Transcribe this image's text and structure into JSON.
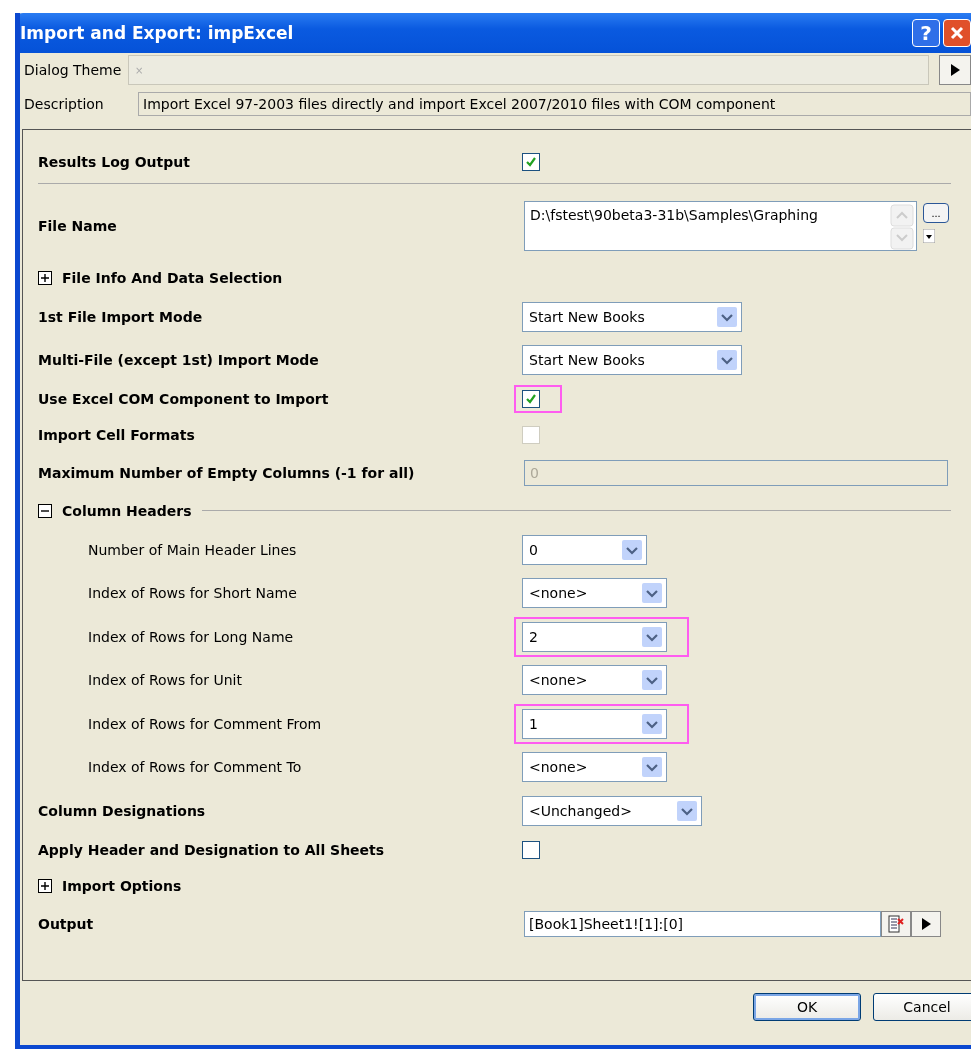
{
  "window": {
    "title": "Import and Export: impExcel",
    "help_button": "?"
  },
  "dialog_theme": {
    "label": "Dialog Theme",
    "placeholder": "×"
  },
  "description": {
    "label": "Description",
    "value": "Import Excel 97-2003 files directly and import Excel 2007/2010 files with COM component"
  },
  "options": [
    {
      "kind": "checkbox",
      "label": "Results Log Output",
      "checked": true,
      "disabled": false,
      "highlighted": false,
      "separator": true
    },
    {
      "kind": "filename",
      "label": "File Name",
      "value": "D:\\fstest\\90beta3-31b\\Samples\\Graphing",
      "browse_button": "..."
    },
    {
      "kind": "group",
      "label": "File Info And Data Selection",
      "expanded": false
    },
    {
      "kind": "dropdown",
      "label": "1st File Import Mode",
      "value": "Start New Books",
      "highlighted": false
    },
    {
      "kind": "dropdown",
      "label": "Multi-File (except 1st) Import Mode",
      "value": "Start New Books",
      "highlighted": false
    },
    {
      "kind": "checkbox",
      "label": "Use Excel COM Component to Import",
      "checked": true,
      "disabled": false,
      "highlighted": true,
      "separator": false
    },
    {
      "kind": "checkbox",
      "label": "Import Cell Formats",
      "checked": false,
      "disabled": true,
      "highlighted": false,
      "separator": false
    },
    {
      "kind": "field",
      "label": "Maximum Number of Empty Columns (-1 for all)",
      "value": "0",
      "disabled": true
    },
    {
      "kind": "group",
      "label": "Column Headers",
      "expanded": true,
      "children": [
        {
          "kind": "dropdown",
          "label": "Number of Main Header Lines",
          "value": "0",
          "highlighted": false
        },
        {
          "kind": "dropdown",
          "label": "Index of Rows for Short Name",
          "value": "<none>",
          "highlighted": false
        },
        {
          "kind": "dropdown",
          "label": "Index of Rows for Long Name",
          "value": "2",
          "highlighted": true
        },
        {
          "kind": "dropdown",
          "label": "Index of Rows for Unit",
          "value": "<none>",
          "highlighted": false
        },
        {
          "kind": "dropdown",
          "label": "Index of Rows for Comment From",
          "value": "1",
          "highlighted": true
        },
        {
          "kind": "dropdown",
          "label": "Index of Rows for Comment To",
          "value": "<none>",
          "highlighted": false
        }
      ]
    },
    {
      "kind": "dropdown",
      "label": "Column Designations",
      "value": "<Unchanged>",
      "highlighted": false
    },
    {
      "kind": "checkbox",
      "label": "Apply Header and Designation to All Sheets",
      "checked": false,
      "disabled": false,
      "highlighted": false,
      "separator": false
    },
    {
      "kind": "group",
      "label": "Import Options",
      "expanded": false
    },
    {
      "kind": "output",
      "label": "Output",
      "value": "[Book1]Sheet1![1]:[0]"
    }
  ],
  "buttons": [
    {
      "label": "OK",
      "default": true
    },
    {
      "label": "Cancel",
      "default": false
    }
  ]
}
